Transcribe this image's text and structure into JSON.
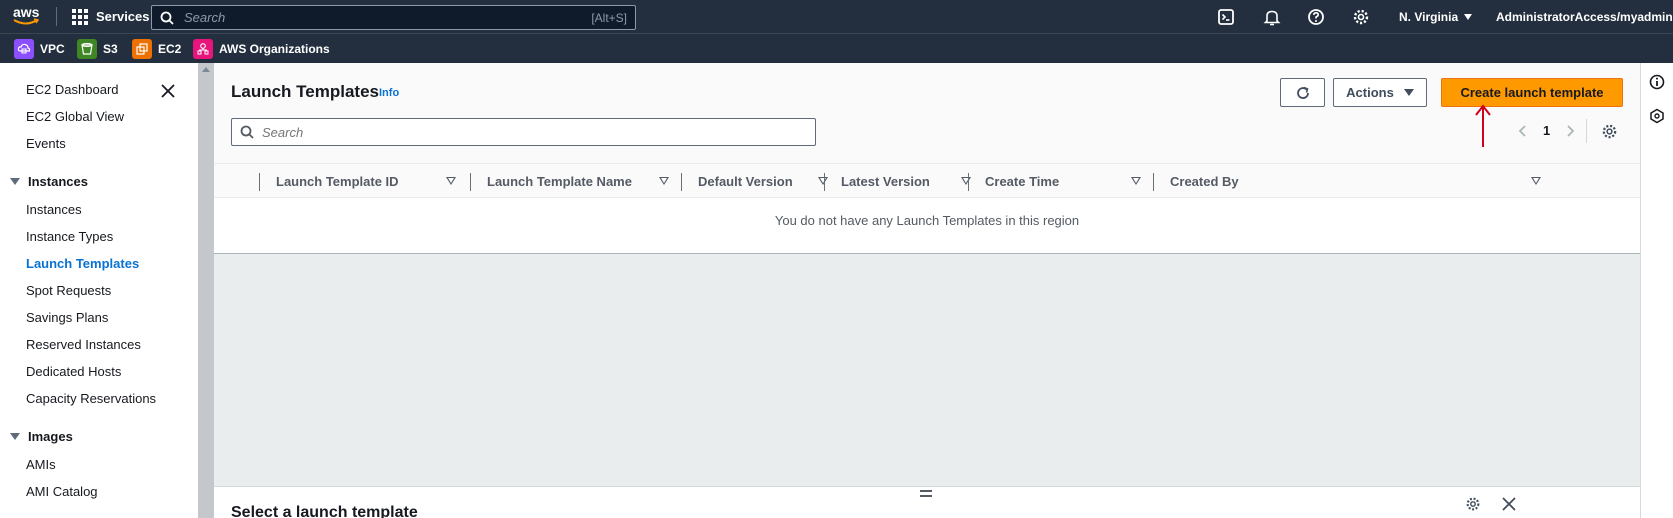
{
  "topnav": {
    "logo_text": "aws",
    "services_label": "Services",
    "search_placeholder": "Search",
    "search_shortcut": "[Alt+S]",
    "region": "N. Virginia",
    "account": "AdministratorAccess/myadmin",
    "icons": [
      "cloudshell-icon",
      "notifications-icon",
      "help-icon",
      "settings-icon"
    ]
  },
  "favorites": [
    {
      "label": "VPC",
      "color": "#8c4fff"
    },
    {
      "label": "S3",
      "color": "#3f8624"
    },
    {
      "label": "EC2",
      "color": "#ed7100"
    },
    {
      "label": "AWS Organizations",
      "color": "#e7157b"
    }
  ],
  "sidebar": {
    "top_items": [
      "EC2 Dashboard",
      "EC2 Global View",
      "Events"
    ],
    "sections": [
      {
        "title": "Instances",
        "items": [
          "Instances",
          "Instance Types",
          "Launch Templates",
          "Spot Requests",
          "Savings Plans",
          "Reserved Instances",
          "Dedicated Hosts",
          "Capacity Reservations"
        ]
      },
      {
        "title": "Images",
        "items": [
          "AMIs",
          "AMI Catalog"
        ]
      }
    ],
    "active_item": "Launch Templates"
  },
  "main": {
    "title": "Launch Templates",
    "info": "Info",
    "actions_label": "Actions",
    "create_label": "Create launch template",
    "search_placeholder": "Search",
    "page_number": "1",
    "columns": [
      "Launch Template ID",
      "Launch Template Name",
      "Default Version",
      "Latest Version",
      "Create Time",
      "Created By"
    ],
    "empty_message": "You do not have any Launch Templates in this region",
    "bottom_panel_title": "Select a launch template"
  },
  "colors": {
    "nav_bg": "#232f3e",
    "primary_button": "#ff9900",
    "link": "#0972d3",
    "annotation_arrow": "#d0021b"
  }
}
